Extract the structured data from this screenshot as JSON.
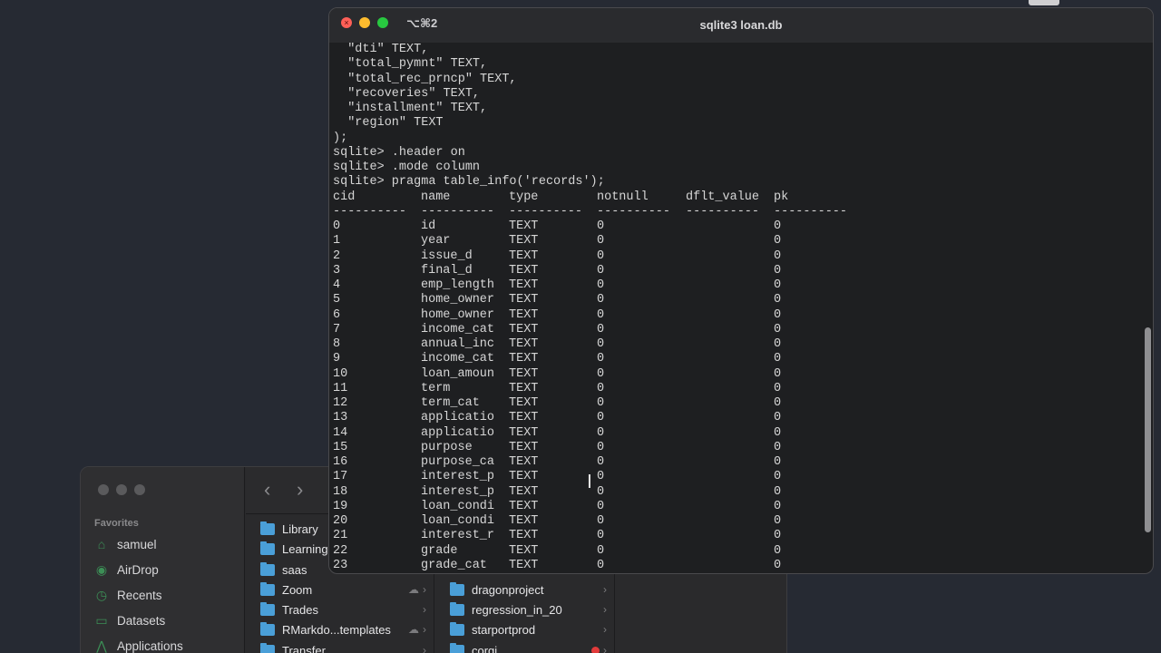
{
  "terminal": {
    "shortcut": "⌥⌘2",
    "title": "sqlite3 loan.db",
    "schema_lines": [
      "  \"dti\" TEXT,",
      "  \"total_pymnt\" TEXT,",
      "  \"total_rec_prncp\" TEXT,",
      "  \"recoveries\" TEXT,",
      "  \"installment\" TEXT,",
      "  \"region\" TEXT",
      ");",
      "sqlite> .header on",
      "sqlite> .mode column",
      "sqlite> pragma table_info('records');"
    ],
    "columns": [
      "cid",
      "name",
      "type",
      "notnull",
      "dflt_value",
      "pk"
    ],
    "separator": "----------",
    "rows": [
      [
        "0",
        "id",
        "TEXT",
        "0",
        "",
        "0"
      ],
      [
        "1",
        "year",
        "TEXT",
        "0",
        "",
        "0"
      ],
      [
        "2",
        "issue_d",
        "TEXT",
        "0",
        "",
        "0"
      ],
      [
        "3",
        "final_d",
        "TEXT",
        "0",
        "",
        "0"
      ],
      [
        "4",
        "emp_length",
        "TEXT",
        "0",
        "",
        "0"
      ],
      [
        "5",
        "home_owner",
        "TEXT",
        "0",
        "",
        "0"
      ],
      [
        "6",
        "home_owner",
        "TEXT",
        "0",
        "",
        "0"
      ],
      [
        "7",
        "income_cat",
        "TEXT",
        "0",
        "",
        "0"
      ],
      [
        "8",
        "annual_inc",
        "TEXT",
        "0",
        "",
        "0"
      ],
      [
        "9",
        "income_cat",
        "TEXT",
        "0",
        "",
        "0"
      ],
      [
        "10",
        "loan_amoun",
        "TEXT",
        "0",
        "",
        "0"
      ],
      [
        "11",
        "term",
        "TEXT",
        "0",
        "",
        "0"
      ],
      [
        "12",
        "term_cat",
        "TEXT",
        "0",
        "",
        "0"
      ],
      [
        "13",
        "applicatio",
        "TEXT",
        "0",
        "",
        "0"
      ],
      [
        "14",
        "applicatio",
        "TEXT",
        "0",
        "",
        "0"
      ],
      [
        "15",
        "purpose",
        "TEXT",
        "0",
        "",
        "0"
      ],
      [
        "16",
        "purpose_ca",
        "TEXT",
        "0",
        "",
        "0"
      ],
      [
        "17",
        "interest_p",
        "TEXT",
        "0",
        "",
        "0"
      ],
      [
        "18",
        "interest_p",
        "TEXT",
        "0",
        "",
        "0"
      ],
      [
        "19",
        "loan_condi",
        "TEXT",
        "0",
        "",
        "0"
      ],
      [
        "20",
        "loan_condi",
        "TEXT",
        "0",
        "",
        "0"
      ],
      [
        "21",
        "interest_r",
        "TEXT",
        "0",
        "",
        "0"
      ],
      [
        "22",
        "grade",
        "TEXT",
        "0",
        "",
        "0"
      ],
      [
        "23",
        "grade_cat",
        "TEXT",
        "0",
        "",
        "0"
      ]
    ]
  },
  "finder": {
    "favorites_title": "Favorites",
    "sidebar_items": [
      {
        "label": "samuel",
        "icon": "home-icon"
      },
      {
        "label": "AirDrop",
        "icon": "airdrop-icon"
      },
      {
        "label": "Recents",
        "icon": "clock-icon"
      },
      {
        "label": "Datasets",
        "icon": "folder-icon"
      },
      {
        "label": "Applications",
        "icon": "applications-icon"
      }
    ],
    "column1": [
      {
        "label": "Library"
      },
      {
        "label": "Learning"
      },
      {
        "label": "saas"
      },
      {
        "label": "Zoom"
      },
      {
        "label": "Trades"
      },
      {
        "label": "RMarkdo...templates"
      },
      {
        "label": "Transfer"
      }
    ],
    "column2": [
      {
        "label": "dragonproject"
      },
      {
        "label": "regression_in_20"
      },
      {
        "label": "starportprod"
      },
      {
        "label": "corgi"
      }
    ]
  },
  "colors": {
    "terminal_bg": "#1e1f21",
    "desktop_bg": "#262a33",
    "folder_blue": "#4a9fd8",
    "sidebar_icon_green": "#3c8f56"
  }
}
